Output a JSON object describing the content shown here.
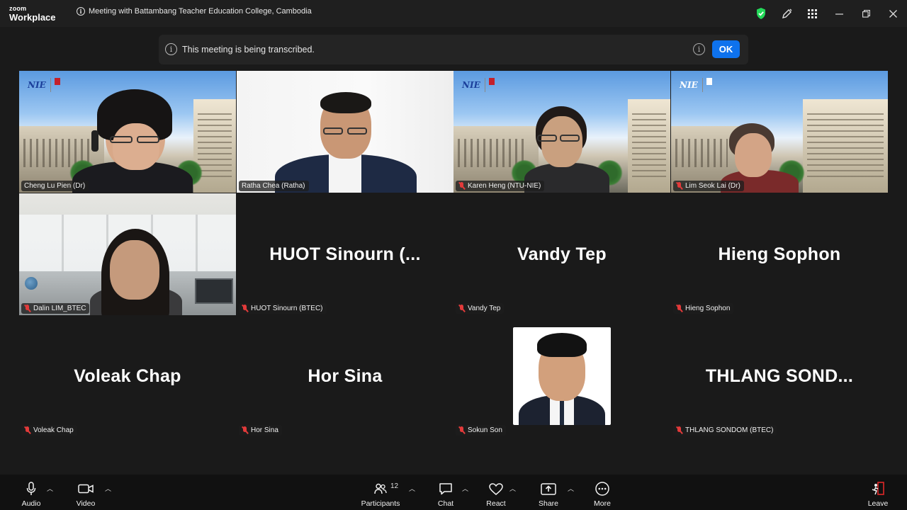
{
  "app": {
    "brand_top": "zoom",
    "brand_bottom": "Workplace",
    "window_title": "Meeting with Battambang Teacher Education College, Cambodia"
  },
  "titlebar_icons": [
    "shield-check-icon",
    "pen-icon",
    "grid-icon",
    "minimize-icon",
    "restore-icon",
    "close-icon"
  ],
  "banner": {
    "text": "This meeting is being transcribed.",
    "ok_label": "OK"
  },
  "participants": [
    {
      "name": "Cheng Lu Pien (Dr)",
      "video": true,
      "muted": false,
      "active_speaker": true
    },
    {
      "name": "Ratha Chea (Ratha)",
      "video": true,
      "muted": false
    },
    {
      "name": "Karen Heng (NTU-NIE)",
      "video": true,
      "muted": true
    },
    {
      "name": "Lim Seok Lai (Dr)",
      "video": true,
      "muted": true
    },
    {
      "name": "Dalin LIM_BTEC",
      "video": true,
      "muted": true
    },
    {
      "name": "HUOT Sinourn (BTEC)",
      "display": "HUOT  Sinourn  (...",
      "video": false,
      "muted": true
    },
    {
      "name": "Vandy Tep",
      "display": "Vandy Tep",
      "video": false,
      "muted": true
    },
    {
      "name": "Hieng Sophon",
      "display": "Hieng Sophon",
      "video": false,
      "muted": true
    },
    {
      "name": "Voleak Chap",
      "display": "Voleak Chap",
      "video": false,
      "muted": true
    },
    {
      "name": "Hor Sina",
      "display": "Hor Sina",
      "video": false,
      "muted": true
    },
    {
      "name": "Sokun Son",
      "video": false,
      "photo": true,
      "muted": true
    },
    {
      "name": "THLANG SONDOM (BTEC)",
      "display": "THLANG  SOND...",
      "video": false,
      "muted": true
    }
  ],
  "toolbar": {
    "audio": "Audio",
    "video": "Video",
    "participants": "Participants",
    "participants_count": "12",
    "chat": "Chat",
    "react": "React",
    "share": "Share",
    "more": "More",
    "leave": "Leave"
  },
  "colors": {
    "active_speaker": "#23d959",
    "ok_button": "#0e72ed",
    "muted_mic": "#e23a3a",
    "security_shield": "#23d959",
    "leave": "#e02828"
  }
}
